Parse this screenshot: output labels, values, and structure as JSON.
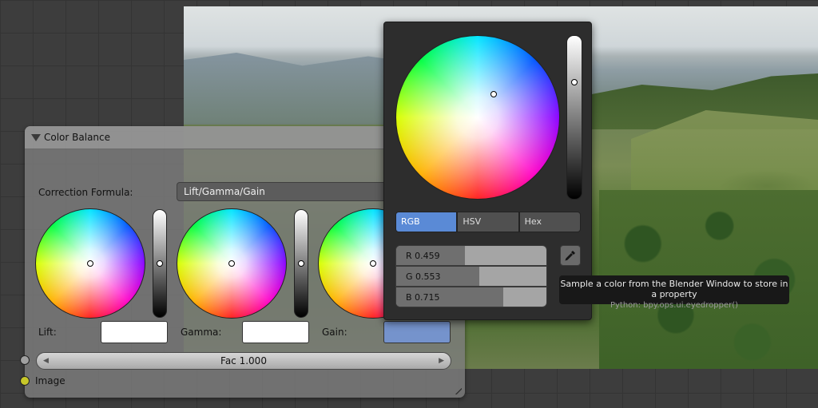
{
  "node": {
    "title": "Color Balance",
    "correction_label": "Correction Formula:",
    "correction_value": "Lift/Gamma/Gain",
    "wheels": [
      {
        "label": "Lift:",
        "swatch_color": "#ffffff",
        "value_level": 0.5
      },
      {
        "label": "Gamma:",
        "swatch_color": "#ffffff",
        "value_level": 0.5
      },
      {
        "label": "Gain:",
        "swatch_color": "#7593cc",
        "value_level": 0.5
      }
    ],
    "fac_label": "Fac 1.000",
    "image_output_label": "Image",
    "socket_colors": {
      "fac": "#a1a1a1",
      "image": "#c7c729"
    }
  },
  "picker": {
    "tabs": [
      "RGB",
      "HSV",
      "Hex"
    ],
    "active_tab": "RGB",
    "channels": [
      {
        "label": "R 0.459",
        "value": 0.459
      },
      {
        "label": "G 0.553",
        "value": 0.553
      },
      {
        "label": "B 0.715",
        "value": 0.715
      }
    ],
    "value_level": 0.715
  },
  "tooltip": {
    "text": "Sample a color from the Blender Window to store in a property",
    "python": "Python: bpy.ops.ui.eyedropper()"
  },
  "icons": [
    "collapse-triangle-icon",
    "eyedropper-icon",
    "arrow-left-icon",
    "arrow-right-icon"
  ]
}
